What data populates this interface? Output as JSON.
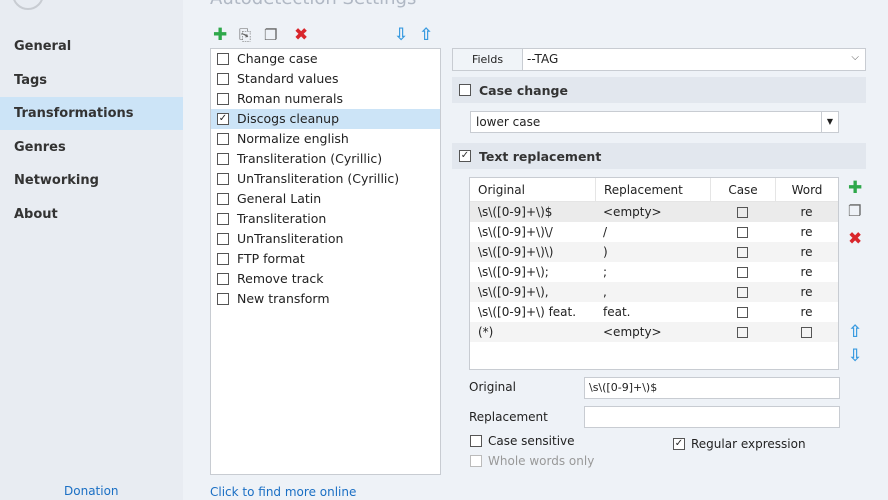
{
  "sidebar": {
    "items": [
      "General",
      "Tags",
      "Transformations",
      "Genres",
      "Networking",
      "About"
    ],
    "selected": 2,
    "donation": "Donation"
  },
  "header": {
    "title": "Autodetection Settings"
  },
  "toolbar": {
    "add": "add-icon",
    "add_copy": "add-file-icon",
    "copy": "copy-icon",
    "delete": "delete-icon",
    "down": "arrow-down-icon",
    "up": "arrow-up-icon"
  },
  "transforms": [
    {
      "label": "Change case",
      "checked": false
    },
    {
      "label": "Standard values",
      "checked": false
    },
    {
      "label": "Roman numerals",
      "checked": false
    },
    {
      "label": "Discogs cleanup",
      "checked": true,
      "selected": true
    },
    {
      "label": "Normalize english",
      "checked": false
    },
    {
      "label": "Transliteration (Cyrillic)",
      "checked": false
    },
    {
      "label": "UnTransliteration (Cyrillic)",
      "checked": false
    },
    {
      "label": "General Latin",
      "checked": false
    },
    {
      "label": "Transliteration",
      "checked": false
    },
    {
      "label": "UnTransliteration",
      "checked": false
    },
    {
      "label": "FTP format",
      "checked": false
    },
    {
      "label": "Remove track",
      "checked": false
    },
    {
      "label": "New transform",
      "checked": false
    }
  ],
  "find_more": "Click to find more online",
  "fields": {
    "label": "Fields",
    "value": "--TAG"
  },
  "case_change": {
    "label": "Case change",
    "checked": false,
    "mode": "lower case"
  },
  "text_replacement": {
    "label": "Text replacement",
    "checked": true
  },
  "table": {
    "headers": [
      "Original",
      "Replacement",
      "Case",
      "Word"
    ],
    "rows": [
      [
        "\\s\\([0-9]+\\)$",
        "<empty>",
        "",
        "re"
      ],
      [
        "\\s\\([0-9]+\\)\\/",
        "/",
        "",
        "re"
      ],
      [
        "\\s\\([0-9]+\\)\\)",
        ")",
        "",
        "re"
      ],
      [
        "\\s\\([0-9]+\\);",
        ";",
        "",
        "re"
      ],
      [
        "\\s\\([0-9]+\\),",
        ",",
        "",
        "re"
      ],
      [
        "\\s\\([0-9]+\\) feat.",
        " feat.",
        "",
        "re"
      ],
      [
        "(*)",
        "<empty>",
        "",
        ""
      ]
    ]
  },
  "form": {
    "original_label": "Original",
    "original_value": "\\s\\([0-9]+\\)$",
    "replacement_label": "Replacement",
    "replacement_value": "",
    "case_sensitive": "Case sensitive",
    "whole_words": "Whole words only",
    "regex": "Regular expression"
  },
  "colors": {
    "accent": "#cce4f7",
    "link": "#1a6fc4",
    "green": "#2ea84a",
    "red": "#d9262c",
    "blue": "#3a9be0"
  }
}
